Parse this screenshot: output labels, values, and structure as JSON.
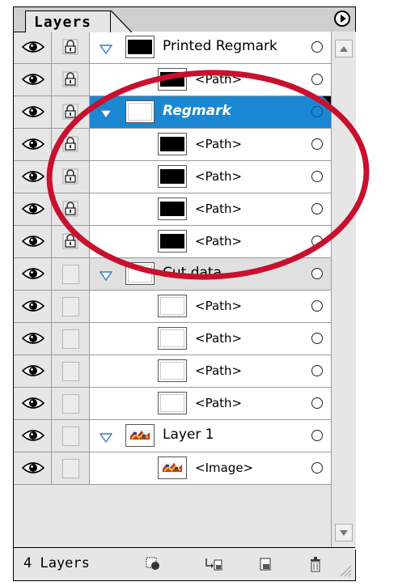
{
  "panel": {
    "tab_label": "Layers",
    "layer_count": "4 Layers"
  },
  "rows": [
    {
      "kind": "layer",
      "name": "Printed Regmark",
      "thumb": "black",
      "lock": true,
      "expanded": true,
      "selected": false
    },
    {
      "kind": "item",
      "name": "<Path>",
      "thumb": "black",
      "lock": true
    },
    {
      "kind": "layer",
      "name": "Regmark",
      "thumb": "white",
      "lock": true,
      "expanded": true,
      "selected": true
    },
    {
      "kind": "item",
      "name": "<Path>",
      "thumb": "black",
      "lock": true
    },
    {
      "kind": "item",
      "name": "<Path>",
      "thumb": "black",
      "lock": true
    },
    {
      "kind": "item",
      "name": "<Path>",
      "thumb": "black",
      "lock": true
    },
    {
      "kind": "item",
      "name": "<Path>",
      "thumb": "black",
      "lock": true
    },
    {
      "kind": "layer",
      "name": "Cut data",
      "thumb": "white",
      "lock": false,
      "expanded": true,
      "selected": false
    },
    {
      "kind": "item",
      "name": "<Path>",
      "thumb": "white",
      "lock": false
    },
    {
      "kind": "item",
      "name": "<Path>",
      "thumb": "white",
      "lock": false
    },
    {
      "kind": "item",
      "name": "<Path>",
      "thumb": "white",
      "lock": false
    },
    {
      "kind": "item",
      "name": "<Path>",
      "thumb": "white",
      "lock": false
    },
    {
      "kind": "layer",
      "name": "Layer 1",
      "thumb": "img",
      "lock": false,
      "expanded": true,
      "selected": false
    },
    {
      "kind": "item",
      "name": "<Image>",
      "thumb": "img",
      "lock": false
    }
  ],
  "colors": {
    "selection": "#1a87d2",
    "annotation": "#c8102e"
  },
  "icons": {
    "visibility": "eye-icon",
    "lock": "lock-icon",
    "expand": "disclosure-triangle-icon",
    "target": "target-circle-icon",
    "menu": "panel-menu-icon",
    "footer": [
      "make-clipping-mask-icon",
      "create-sublayer-icon",
      "create-layer-icon",
      "delete-layer-icon"
    ]
  }
}
